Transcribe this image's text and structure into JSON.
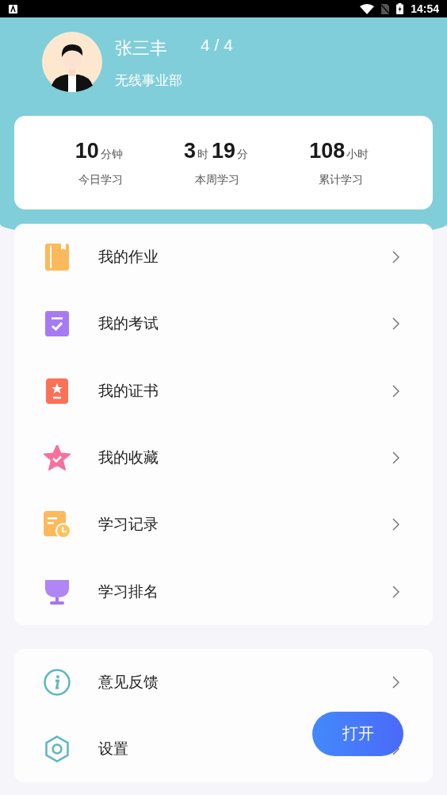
{
  "status_bar": {
    "time": "14:54"
  },
  "profile": {
    "name": "张三丰",
    "progress": "4 / 4",
    "department": "无线事业部"
  },
  "stats": [
    {
      "parts": [
        {
          "num": "10",
          "unit": "分钟"
        }
      ],
      "label": "今日学习"
    },
    {
      "parts": [
        {
          "num": "3",
          "unit": "时"
        },
        {
          "num": "19",
          "unit": "分"
        }
      ],
      "label": "本周学习"
    },
    {
      "parts": [
        {
          "num": "108",
          "unit": "小时"
        }
      ],
      "label": "累计学习"
    }
  ],
  "menu": [
    {
      "label": "我的作业"
    },
    {
      "label": "我的考试"
    },
    {
      "label": "我的证书"
    },
    {
      "label": "我的收藏"
    },
    {
      "label": "学习记录"
    },
    {
      "label": "学习排名"
    }
  ],
  "more_menu": [
    {
      "label": "意见反馈"
    },
    {
      "label": "设置"
    }
  ],
  "floating_button": {
    "label": "打开"
  }
}
